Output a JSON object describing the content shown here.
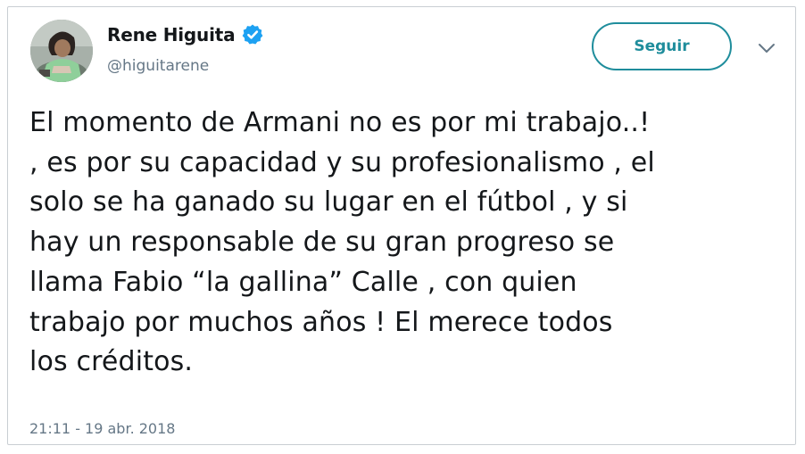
{
  "author": {
    "display_name": "Rene Higuita",
    "handle": "@higuitarene",
    "verified": true,
    "avatar_icon": "profile-photo"
  },
  "actions": {
    "follow_label": "Seguir",
    "menu_icon": "chevron-down-icon"
  },
  "tweet": {
    "text": "El momento de Armani no es por mi trabajo..!\n, es por su capacidad y su profesionalismo , el\nsolo se ha ganado su lugar en el fútbol , y si\nhay un responsable de su gran progreso se\nllama Fabio “la gallina” Calle , con quien\ntrabajo por muchos años ! El merece todos\nlos créditos.",
    "timestamp": "21:11 - 19 abr. 2018"
  },
  "colors": {
    "accent": "#1f8d9c",
    "verified_badge": "#1da1f2",
    "secondary_text": "#657786",
    "primary_text": "#14171a"
  }
}
